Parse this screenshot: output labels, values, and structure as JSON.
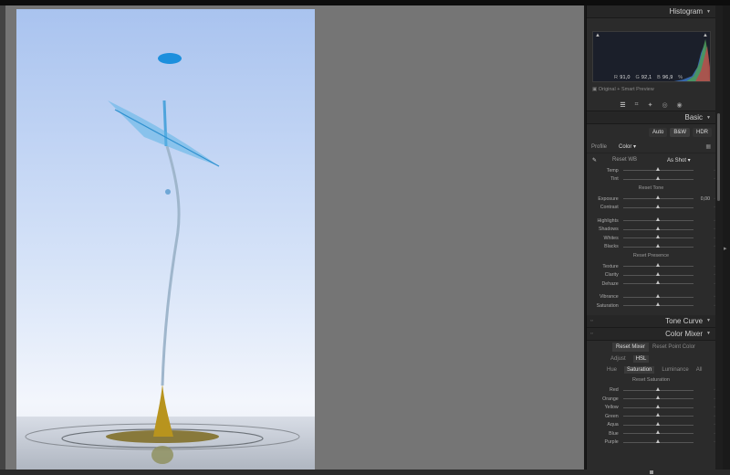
{
  "histogram": {
    "title": "Histogram",
    "r_label": "R",
    "r_value": "91,0",
    "g_label": "G",
    "g_value": "92,1",
    "b_label": "B",
    "b_value": "96,9",
    "unit": "%",
    "preview": "Original + Smart Preview"
  },
  "basic": {
    "title": "Basic",
    "auto": "Auto",
    "bw": "B&W",
    "hdr": "HDR",
    "profile_label": "Profile",
    "profile_value": "Color",
    "reset_wb": "Reset WB",
    "wb_value": "As Shot",
    "wb_sliders": [
      {
        "name": "Temp",
        "pos": 0.5,
        "value": ""
      },
      {
        "name": "Tint",
        "pos": 0.5,
        "value": ""
      }
    ],
    "reset_tone": "Reset Tone",
    "tone_sliders": [
      {
        "name": "Exposure",
        "pos": 0.5,
        "value": "0,00"
      },
      {
        "name": "Contrast",
        "pos": 0.5,
        "value": ""
      }
    ],
    "tone_sliders_2": [
      {
        "name": "Highlights",
        "pos": 0.5,
        "value": ""
      },
      {
        "name": "Shadows",
        "pos": 0.5,
        "value": ""
      },
      {
        "name": "Whites",
        "pos": 0.5,
        "value": ""
      },
      {
        "name": "Blacks",
        "pos": 0.5,
        "value": ""
      }
    ],
    "reset_presence": "Reset Presence",
    "presence_sliders": [
      {
        "name": "Texture",
        "pos": 0.5,
        "value": ""
      },
      {
        "name": "Clarity",
        "pos": 0.5,
        "value": ""
      },
      {
        "name": "Dehaze",
        "pos": 0.5,
        "value": ""
      }
    ],
    "presence_sliders_2": [
      {
        "name": "Vibrance",
        "pos": 0.5,
        "value": ""
      },
      {
        "name": "Saturation",
        "pos": 0.5,
        "value": ""
      }
    ]
  },
  "tone_curve": {
    "title": "Tone Curve"
  },
  "color_mixer": {
    "title": "Color Mixer",
    "reset_mixer": "Reset Mixer",
    "reset_point": "Reset Point Color",
    "adjust_label": "Adjust",
    "hsl": "HSL",
    "tabs": [
      "Hue",
      "Saturation",
      "Luminance",
      "All"
    ],
    "reset_saturation": "Reset Saturation",
    "sliders": [
      {
        "name": "Red",
        "pos": 0.5
      },
      {
        "name": "Orange",
        "pos": 0.5
      },
      {
        "name": "Yellow",
        "pos": 0.5
      },
      {
        "name": "Green",
        "pos": 0.5
      },
      {
        "name": "Aqua",
        "pos": 0.5
      },
      {
        "name": "Blue",
        "pos": 0.5
      },
      {
        "name": "Purple",
        "pos": 0.5
      }
    ]
  }
}
